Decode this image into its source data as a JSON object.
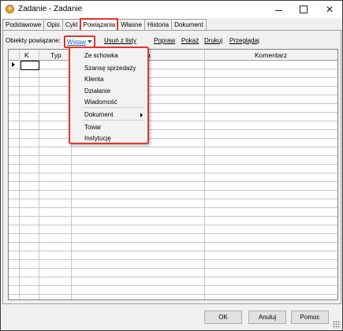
{
  "window": {
    "title": "Zadanie - Zadanie",
    "icon": "app-icon",
    "controls": {
      "minimize": "minimize-icon",
      "maximize": "maximize-icon",
      "close": "✕"
    }
  },
  "tabs": [
    {
      "label": "Podstawowe"
    },
    {
      "label": "Opis"
    },
    {
      "label": "Cykl"
    },
    {
      "label": "Powiązania",
      "active": true
    },
    {
      "label": "Własne"
    },
    {
      "label": "Historia"
    },
    {
      "label": "Dokument"
    }
  ],
  "toolbar": {
    "label": "Obiekty powiązane:",
    "insert_dropdown": "Wstaw",
    "remove_link": "Usuń z listy",
    "edit_link": "Popraw",
    "show_link": "Pokaż",
    "print_link": "Drukuj",
    "browse_link": "Przeglądaj"
  },
  "grid": {
    "columns": [
      "K",
      "Typ",
      "",
      "Komentarz"
    ],
    "visible_column_fragment": "a",
    "rows": []
  },
  "insert_menu": {
    "items": [
      {
        "label": "Ze schowka"
      },
      {
        "label": "Szansę sprzedaży"
      },
      {
        "label": "Klienta"
      },
      {
        "label": "Działanie"
      },
      {
        "label": "Wiadomość"
      },
      {
        "label": "Dokument",
        "submenu": true
      },
      {
        "label": "Towar"
      },
      {
        "label": "Instytucję"
      }
    ]
  },
  "footer": {
    "ok": "OK",
    "cancel": "Anuluj",
    "help": "Pomoc"
  },
  "colors": {
    "highlight": "#e0352b",
    "link": "#1a5fb4"
  }
}
